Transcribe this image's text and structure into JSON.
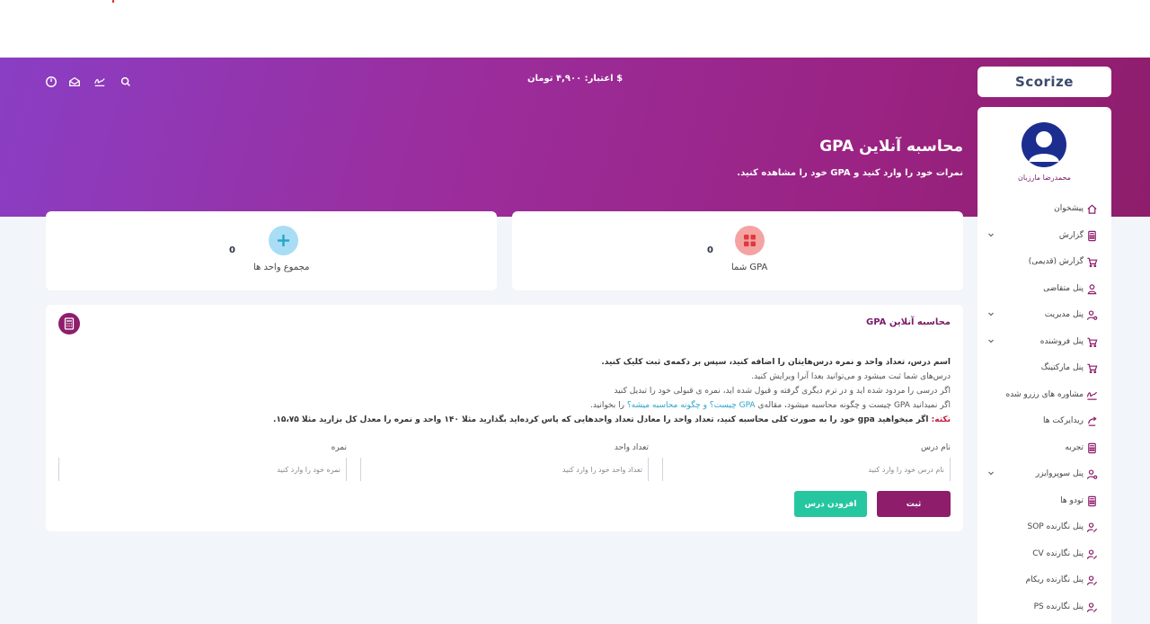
{
  "header": {
    "credit_text": "$ اعتبار: ۴,۹۰۰ تومان",
    "title": "محاسبه آنلاین GPA",
    "subtitle": "نمرات خود را وارد کنید و GPA خود را مشاهده کنید."
  },
  "brand": {
    "name": "Scorize"
  },
  "user": {
    "name": "محمدرضا مارزبان"
  },
  "sidebar": {
    "items": [
      {
        "label": "پیشخوان",
        "icon": "home-icon",
        "has_submenu": false
      },
      {
        "label": "گزارش",
        "icon": "calculator-icon",
        "has_submenu": true
      },
      {
        "label": "گزارش (قدیمی)",
        "icon": "cart-icon",
        "has_submenu": false
      },
      {
        "label": "پنل متقاضی",
        "icon": "user-icon",
        "has_submenu": false
      },
      {
        "label": "پنل مدیریت",
        "icon": "user-gear-icon",
        "has_submenu": true
      },
      {
        "label": "پنل فروشنده",
        "icon": "cart-icon",
        "has_submenu": true
      },
      {
        "label": "پنل مارکتینگ",
        "icon": "cart-icon",
        "has_submenu": false
      },
      {
        "label": "مشاوره های رزرو شده",
        "icon": "signature-icon",
        "has_submenu": false
      },
      {
        "label": "ریدایرکت ها",
        "icon": "redirect-icon",
        "has_submenu": false
      },
      {
        "label": "تجربه",
        "icon": "calculator-icon",
        "has_submenu": false
      },
      {
        "label": "پنل سوپروایزر",
        "icon": "user-gear-icon",
        "has_submenu": true
      },
      {
        "label": "تودو ها",
        "icon": "calculator-icon",
        "has_submenu": false
      },
      {
        "label": "پنل نگارنده SOP",
        "icon": "user-edit-icon",
        "has_submenu": false
      },
      {
        "label": "پنل نگارنده CV",
        "icon": "user-edit-icon",
        "has_submenu": false
      },
      {
        "label": "پنل نگارنده ریکام",
        "icon": "user-edit-icon",
        "has_submenu": false
      },
      {
        "label": "پنل نگارنده PS",
        "icon": "user-edit-icon",
        "has_submenu": false
      }
    ]
  },
  "stats": {
    "gpa": {
      "label": "GPA شما",
      "value": "0",
      "color": "#f4a3a3",
      "icon": "grid-icon"
    },
    "units": {
      "label": "مجموع واحد ها",
      "value": "0",
      "color": "#a8ddf5",
      "icon": "plus-icon"
    }
  },
  "calculator": {
    "title": "محاسبه آنلاین GPA",
    "line1": "اسم درس، تعداد واحد و نمره درس‌هایتان را اضافه کنید، سپس بر دکمه‌ی ثبت کلیک کنید.",
    "line2": "درس‌های شما ثبت میشود و می‌توانید بعدا آنرا ویرایش کنید.",
    "line3": "اگر درسی را مردود شده اید و در ترم دیگری گرفته و قبول شده اید، نمره ی قبولی خود را تبدیل کنید",
    "line4_pre": "اگر نمیدانید GPA چیست و چگونه محاسبه میشود، مقاله‌ی",
    "line4_link": "GPA چیست؟ و چگونه محاسبه میشه؟",
    "line4_post": "را بخوانید.",
    "note_label": "نکته:",
    "note_text": "اگر میخواهید gpa خود را به صورت کلی محاسبه کنید، تعداد واحد را معادل تعداد واحدهایی که پاس کرده‌اید بگذارید مثلا ۱۴۰ واحد و نمره را معدل کل بزارید مثلا ۱۵،۷۵.",
    "fields": {
      "course_label": "نام درس",
      "course_placeholder": "نام درس خود را وارد کنید",
      "units_label": "تعداد واحد",
      "units_placeholder": "تعداد واحد خود را وارد کنید",
      "grade_label": "نمره",
      "grade_placeholder": "نمره خود را وارد کنید"
    },
    "submit_label": "ثبت",
    "add_label": "افزودن درس",
    "submit_color": "#8e1d6b",
    "add_color": "#26c6a0"
  }
}
